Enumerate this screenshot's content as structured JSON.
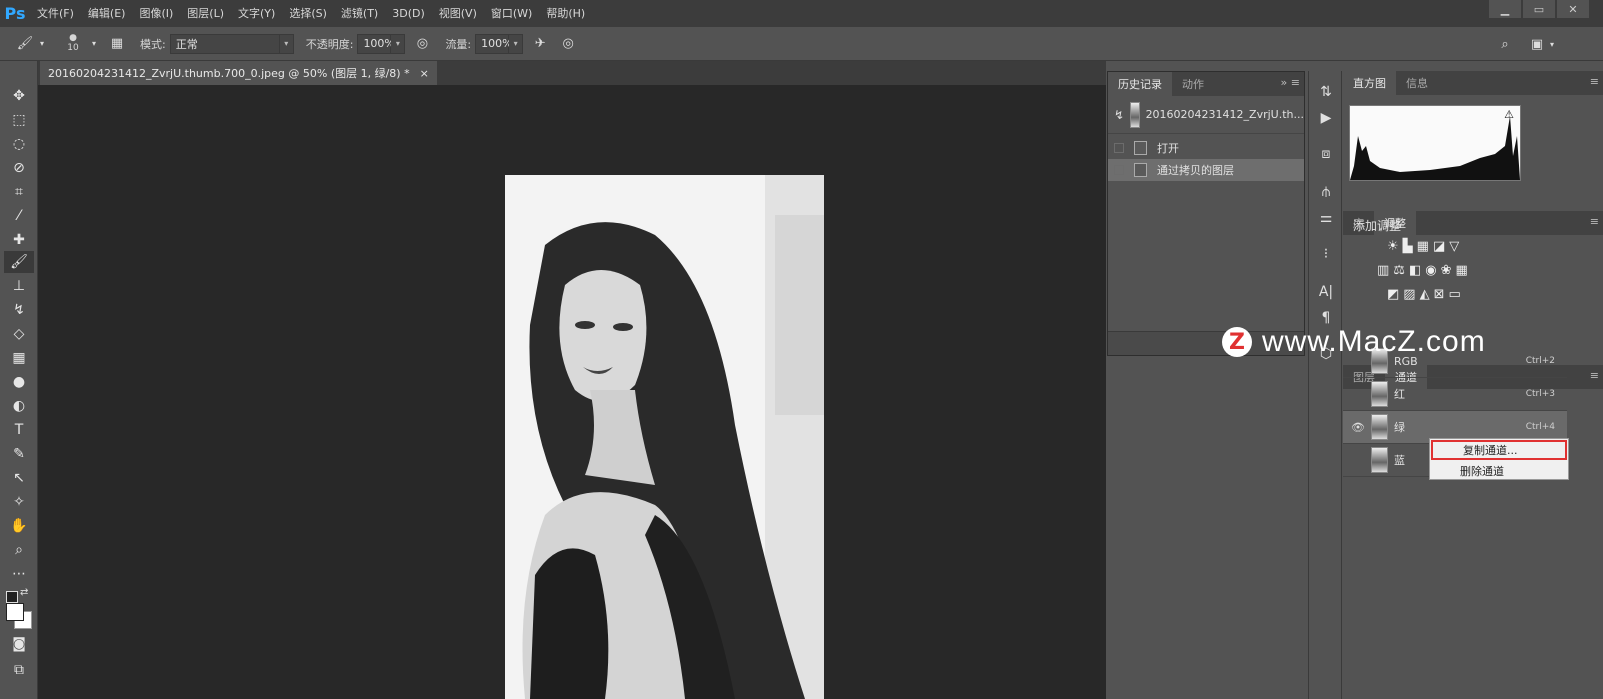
{
  "app": {
    "logo": "Ps"
  },
  "menu": [
    "文件(F)",
    "编辑(E)",
    "图像(I)",
    "图层(L)",
    "文字(Y)",
    "选择(S)",
    "滤镜(T)",
    "3D(D)",
    "视图(V)",
    "窗口(W)",
    "帮助(H)"
  ],
  "window_controls": [
    "minimize-icon",
    "maximize-icon",
    "close-icon"
  ],
  "options": {
    "brush_size": "10",
    "mode_label": "模式:",
    "mode_value": "正常",
    "opacity_label": "不透明度:",
    "opacity_value": "100%",
    "flow_label": "流量:",
    "flow_value": "100%"
  },
  "document": {
    "tab_title": "20160204231412_ZvrjU.thumb.700_0.jpeg @ 50% (图层 1, 绿/8) *",
    "close": "×"
  },
  "history_panel": {
    "tabs": [
      "历史记录",
      "动作"
    ],
    "snapshot": "20160204231412_ZvrjU.th...",
    "items": [
      "打开",
      "通过拷贝的图层"
    ]
  },
  "histogram_panel": {
    "tabs": [
      "直方图",
      "信息"
    ]
  },
  "adjustments_panel": {
    "tabs": [
      "库",
      "调整"
    ],
    "title": "添加调整"
  },
  "channels_panel": {
    "tabs": [
      "图层",
      "通道"
    ],
    "channels": [
      {
        "name": "RGB",
        "shortcut": "Ctrl+2"
      },
      {
        "name": "红",
        "shortcut": "Ctrl+3"
      },
      {
        "name": "绿",
        "shortcut": "Ctrl+4"
      },
      {
        "name": "蓝",
        "shortcut": ""
      }
    ]
  },
  "context_menu": {
    "items": [
      "复制通道...",
      "删除通道"
    ]
  },
  "watermark": {
    "logo": "Z",
    "text": "www.MacZ.com"
  },
  "colors": {
    "accent_red": "#e03131",
    "ps_blue": "#31a8ff"
  }
}
